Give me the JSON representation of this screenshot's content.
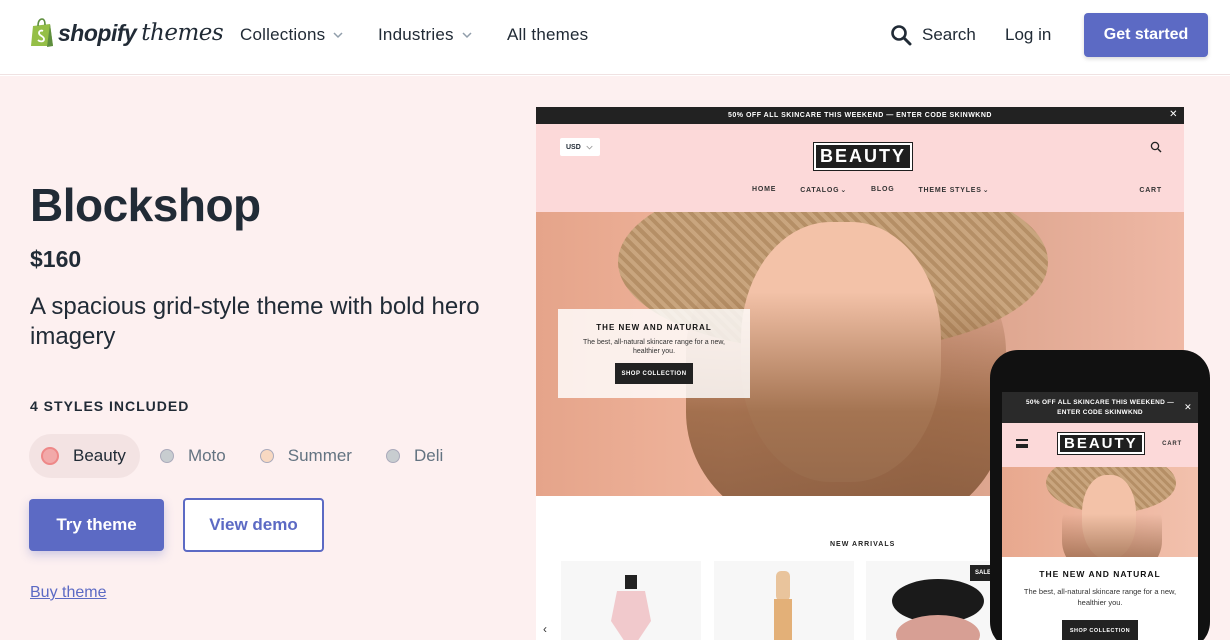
{
  "header": {
    "logo_brand": "shopify",
    "logo_brand2": "themes",
    "nav": [
      {
        "label": "Collections",
        "has_dropdown": true
      },
      {
        "label": "Industries",
        "has_dropdown": true
      },
      {
        "label": "All themes",
        "has_dropdown": false
      }
    ],
    "search_label": "Search",
    "login_label": "Log in",
    "cta_label": "Get started"
  },
  "theme": {
    "name": "Blockshop",
    "price": "$160",
    "description": "A spacious grid-style theme with bold hero imagery",
    "styles_label": "4 STYLES INCLUDED",
    "styles": [
      {
        "label": "Beauty",
        "color": "#f2a9a9",
        "selected": true
      },
      {
        "label": "Moto",
        "color": "#c8cdd0",
        "selected": false
      },
      {
        "label": "Summer",
        "color": "#f8d9c2",
        "selected": false
      },
      {
        "label": "Deli",
        "color": "#c8cdd0",
        "selected": false
      }
    ],
    "try_label": "Try theme",
    "demo_label": "View demo",
    "buy_label": "Buy theme"
  },
  "desktop_preview": {
    "announcement": "50% OFF ALL SKINCARE THIS WEEKEND — ENTER CODE SKINWKND",
    "close": "✕",
    "currency": "USD",
    "logo": "BEAUTY",
    "menu": [
      "HOME",
      "CATALOG",
      "BLOG",
      "THEME STYLES"
    ],
    "cart": "CART",
    "promo_title": "THE NEW AND NATURAL",
    "promo_desc": "The best, all-natural skincare range for a new, healthier you.",
    "promo_button": "SHOP COLLECTION",
    "section_title": "NEW ARRIVALS",
    "sale_badge": "SALE",
    "carousel_prev": "‹"
  },
  "mobile_preview": {
    "announcement_line1": "50% OFF ALL SKINCARE THIS WEEKEND —",
    "announcement_line2": "ENTER CODE SKINWKND",
    "close": "✕",
    "logo": "BEAUTY",
    "cart": "CART",
    "promo_title": "THE NEW AND NATURAL",
    "promo_desc": "The best, all-natural skincare range for a new, healthier you.",
    "promo_button": "SHOP COLLECTION"
  },
  "colors": {
    "accent": "#5c6ac4",
    "hero_bg": "#fdf0f0",
    "preview_pink": "#fcd9d9"
  }
}
